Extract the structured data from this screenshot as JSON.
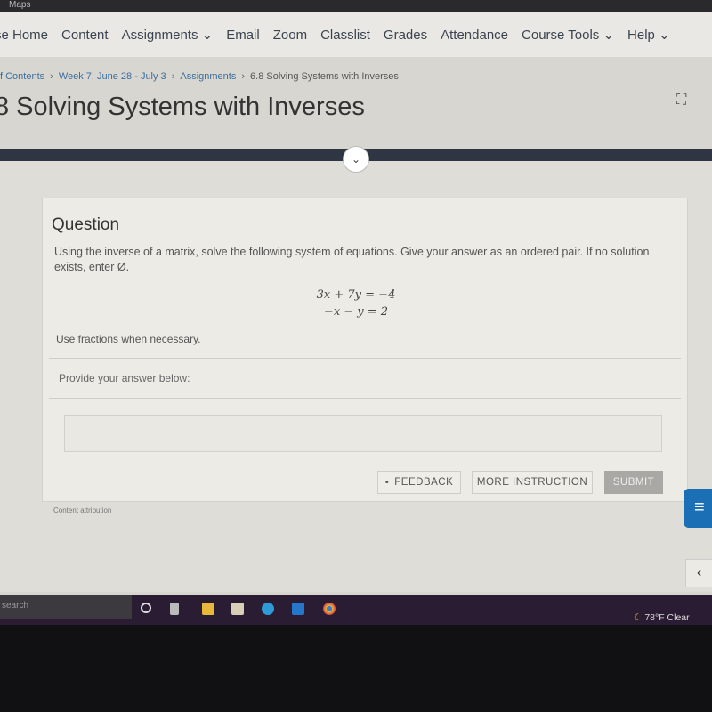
{
  "bookmarks": [
    "Maps"
  ],
  "nav": [
    "se Home",
    "Content",
    "Assignments",
    "Email",
    "Zoom",
    "Classlist",
    "Grades",
    "Attendance",
    "Course Tools",
    "Help"
  ],
  "breadcrumb": [
    "f Contents",
    "Week 7: June 28 - July 3",
    "Assignments",
    "6.8 Solving Systems with Inverses"
  ],
  "page_title": "8 Solving Systems with Inverses",
  "question": {
    "heading": "Question",
    "text": "Using the inverse of a matrix, solve the following system of equations. Give your answer as an ordered pair. If no solution exists, enter Ø.",
    "equations": [
      "3x + 7y = −4",
      "−x − y = 2"
    ],
    "hint": "Use fractions when necessary.",
    "answer_prompt": "Provide your answer below:",
    "answer_value": ""
  },
  "buttons": {
    "feedback": "FEEDBACK",
    "more": "MORE INSTRUCTION",
    "submit": "SUBMIT"
  },
  "attribution": "Content attribution",
  "taskbar": {
    "search": "search",
    "weather": "78°F  Clear"
  },
  "colors": {
    "chat": "#1a6fb5",
    "header_bar": "#2f3542",
    "taskbar": "#2a1c33"
  }
}
